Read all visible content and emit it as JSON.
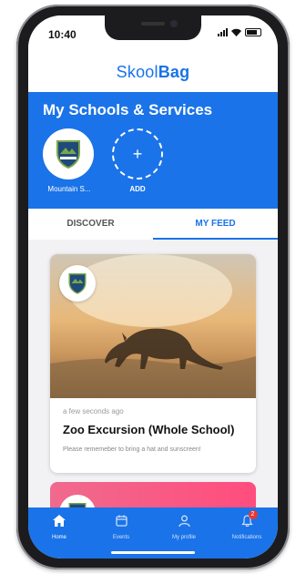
{
  "status": {
    "time": "10:40"
  },
  "app": {
    "logo_part1": "Skool",
    "logo_part2": "Bag"
  },
  "schools": {
    "heading": "My Schools & Services",
    "items": [
      {
        "label": "Mountain S..."
      }
    ],
    "add_label": "ADD",
    "add_symbol": "+"
  },
  "tabs": [
    {
      "label": "DISCOVER",
      "active": false
    },
    {
      "label": "MY FEED",
      "active": true
    }
  ],
  "feed": [
    {
      "timestamp": "a few seconds ago",
      "title": "Zoo Excursion (Whole School)",
      "description": "Please rememeber to bring a hat and sunscreen!"
    }
  ],
  "nav": [
    {
      "label": "Home",
      "icon": "home-icon",
      "active": true
    },
    {
      "label": "Events",
      "icon": "calendar-icon",
      "active": false
    },
    {
      "label": "My profile",
      "icon": "person-icon",
      "active": false
    },
    {
      "label": "Notifications",
      "icon": "bell-icon",
      "active": false,
      "badge": "2"
    }
  ],
  "colors": {
    "primary": "#1a73e8",
    "badge": "#e53935",
    "card2": "#f06a8d"
  }
}
